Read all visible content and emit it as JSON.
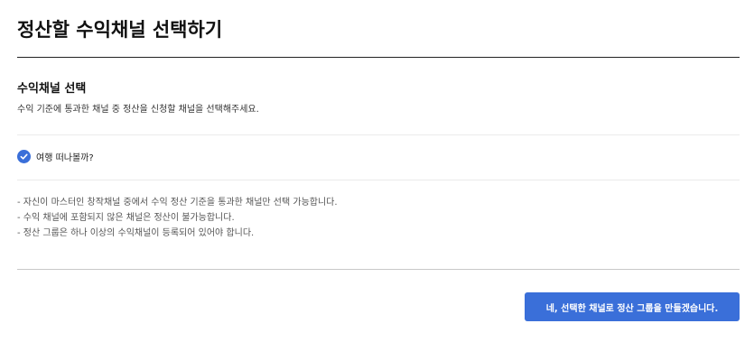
{
  "page": {
    "title": "정산할 수익채널 선택하기"
  },
  "section": {
    "heading": "수익채널 선택",
    "description": "수익 기준에 통과한 채널 중 정산을 신청할 채널을 선택해주세요."
  },
  "channels": [
    {
      "name": "여행 떠나볼까?",
      "selected": true,
      "icon": "check-circle-icon"
    }
  ],
  "notes": [
    "- 자신이 마스터인 창작채널 중에서 수익 정산 기준을 통과한 채널만 선택 가능합니다.",
    "- 수익 채널에 포함되지 않은 채널은 정산이 불가능합니다.",
    "- 정산 그룹은 하나 이상의 수익채널이 등록되어 있어야 합니다."
  ],
  "actions": {
    "confirm_label": "네, 선택한 채널로 정산 그룹을 만들겠습니다."
  },
  "colors": {
    "accent": "#3a6fd9",
    "text_primary": "#111111",
    "text_secondary": "#555555",
    "divider": "#ebebeb"
  }
}
